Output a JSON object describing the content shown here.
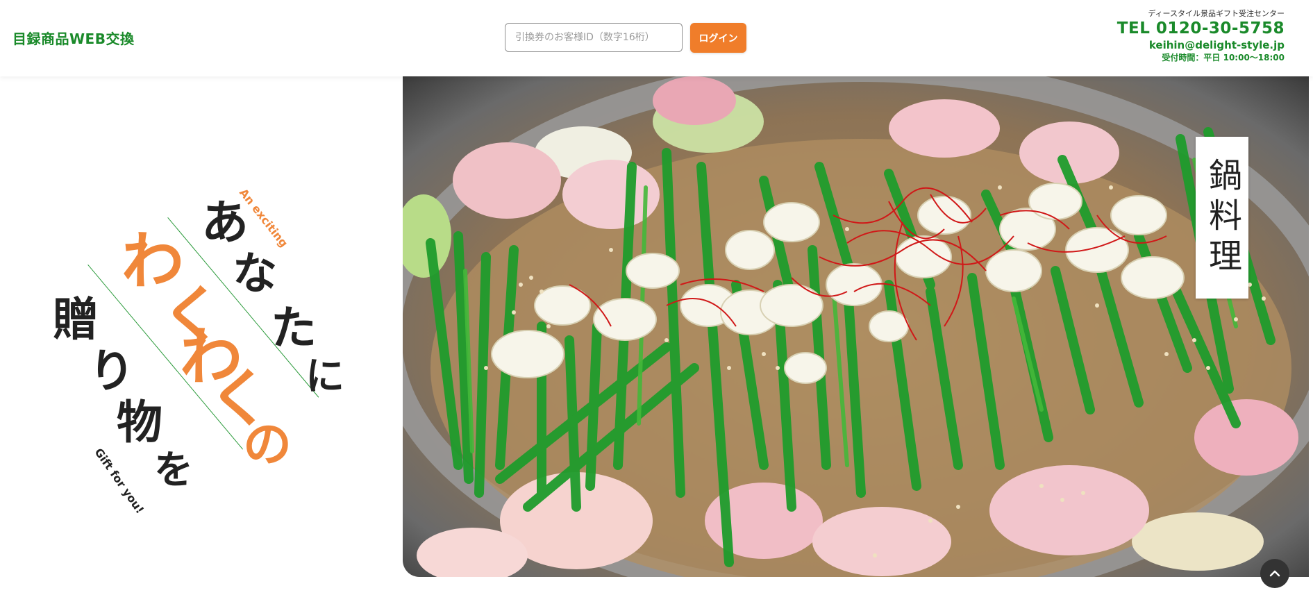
{
  "header": {
    "logo_text": "目録商品WEB交換",
    "search_placeholder": "引換券のお客様ID（数字16桁）",
    "login_label": "ログイン",
    "contact": {
      "center_name": "ディースタイル景品ギフト受注センター",
      "tel": "TEL 0120-30-5758",
      "email": "keihin@delight-style.jp",
      "hours": "受付時間：平日 10:00〜18:00"
    }
  },
  "hero": {
    "title_tag": "鍋料理",
    "catch_copy": {
      "line1": "あなたに",
      "line2": "わくわくの",
      "line3": "贈り物を",
      "en_top": "An exciting",
      "en_bottom": "Gift for you!"
    }
  },
  "colors": {
    "brand_green": "#1a8a2a",
    "accent_orange": "#f07d2a",
    "dark_text": "#222222"
  },
  "icons": {
    "scroll_top": "chevron-up-icon"
  }
}
